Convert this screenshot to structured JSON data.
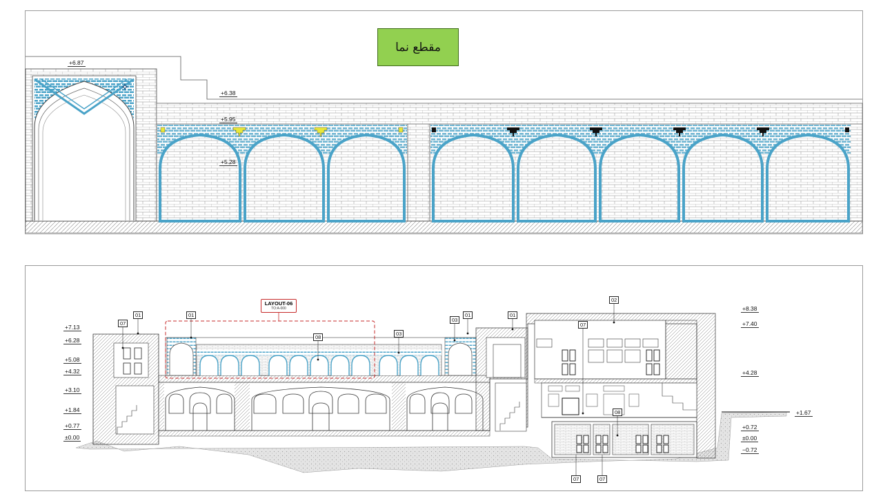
{
  "title": "مقطع نما",
  "elevation_levels": [
    "+6.87",
    "+6.38",
    "+5.95",
    "+5.28"
  ],
  "section_levels_left": [
    "+7.13",
    "+6.28",
    "+5.08",
    "+4.32",
    "+3.10",
    "+1.84",
    "+0.77",
    "±0.00"
  ],
  "section_levels_right": [
    "+8.38",
    "+7.40",
    "+4.28",
    "+1.67",
    "+0.72",
    "±0.00",
    "−0.72"
  ],
  "tags": [
    "07",
    "01",
    "01",
    "08",
    "03",
    "03",
    "01",
    "01",
    "02",
    "07",
    "08",
    "07",
    "07"
  ],
  "layout_ref": {
    "title": "LAYOUT-06",
    "sub": "TO:A-000"
  },
  "colors": {
    "title_bg": "#92d050",
    "tile_blue": "#4aa3c8",
    "tile_yellow": "#e8e83a",
    "tile_black": "#111111",
    "layout_marker": "#c62828"
  },
  "icons": [
    "star-ornament-icon",
    "level-marker-icon"
  ]
}
